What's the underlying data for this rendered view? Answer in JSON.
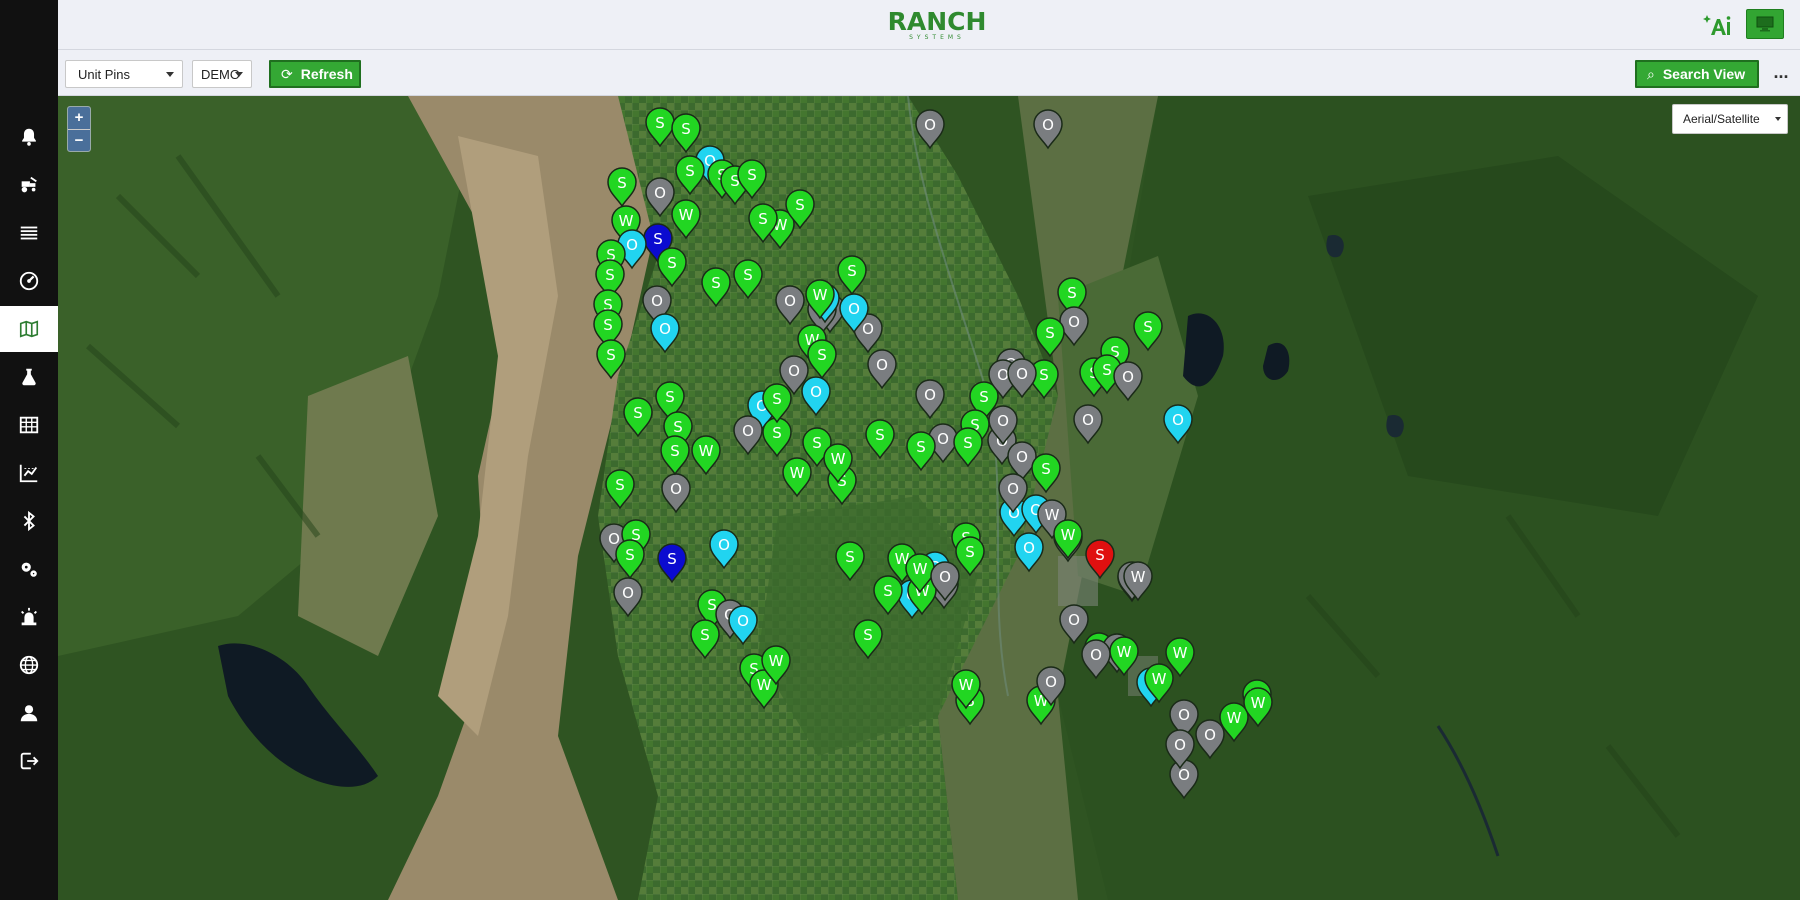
{
  "app": {
    "logo_text": "RANCH",
    "logo_subtext": "SYSTEMS"
  },
  "sidebar": {
    "items": [
      {
        "icon": "bell-icon"
      },
      {
        "icon": "tractor-icon"
      },
      {
        "icon": "list-icon"
      },
      {
        "icon": "gauge-icon"
      },
      {
        "icon": "map-icon",
        "active": true
      },
      {
        "icon": "flask-icon"
      },
      {
        "icon": "table-icon"
      },
      {
        "icon": "chart-grid-icon"
      },
      {
        "icon": "bluetooth-icon"
      },
      {
        "icon": "settings-icon"
      },
      {
        "icon": "alarm-icon"
      },
      {
        "icon": "globe-icon"
      },
      {
        "icon": "user-icon"
      },
      {
        "icon": "logout-icon"
      }
    ]
  },
  "toolbar": {
    "view_select": "Unit Pins",
    "account_select": "DEMO",
    "refresh_label": "Refresh",
    "search_view_label": "Search View",
    "more_label": "..."
  },
  "map": {
    "zoom_in": "+",
    "zoom_out": "−",
    "layer_select": "Aerial/Satellite",
    "pin_colors": {
      "S": "#22d622",
      "W": "#22d622",
      "O": "#7a7d80",
      "cyan": "#21d4f0",
      "blue": "#0b0bd0",
      "red": "#e01010"
    },
    "pins": [
      {
        "label": "S",
        "color": "green"
      },
      {
        "label": "S",
        "color": "green"
      },
      {
        "label": "O",
        "color": "gray"
      },
      {
        "label": "O",
        "color": "gray"
      },
      {
        "label": "S",
        "color": "green"
      },
      {
        "label": "W",
        "color": "green"
      },
      {
        "label": "O",
        "color": "cyan"
      },
      {
        "label": "S",
        "color": "green"
      },
      {
        "label": "S",
        "color": "green"
      },
      {
        "label": "O",
        "color": "gray"
      },
      {
        "label": "W",
        "color": "green"
      },
      {
        "label": "S",
        "color": "blue"
      },
      {
        "label": "S",
        "color": "green"
      },
      {
        "label": "S",
        "color": "green"
      },
      {
        "label": "W",
        "color": "green"
      },
      {
        "label": "S",
        "color": "green"
      },
      {
        "label": "S",
        "color": "green"
      },
      {
        "label": "O",
        "color": "cyan"
      },
      {
        "label": "O",
        "color": "gray"
      },
      {
        "label": "S",
        "color": "green"
      },
      {
        "label": "S",
        "color": "green"
      },
      {
        "label": "S",
        "color": "green"
      },
      {
        "label": "S",
        "color": "green"
      },
      {
        "label": "O",
        "color": "gray"
      },
      {
        "label": "S",
        "color": "green"
      },
      {
        "label": "S",
        "color": "green"
      },
      {
        "label": "S",
        "color": "green"
      },
      {
        "label": "S",
        "color": "green"
      },
      {
        "label": "O",
        "color": "cyan"
      },
      {
        "label": "O",
        "color": "cyan"
      },
      {
        "label": "O",
        "color": "cyan"
      },
      {
        "label": "W",
        "color": "green"
      },
      {
        "label": "S",
        "color": "green"
      },
      {
        "label": "W",
        "color": "green"
      },
      {
        "label": "S",
        "color": "green"
      },
      {
        "label": "S",
        "color": "green"
      },
      {
        "label": "O",
        "color": "gray"
      },
      {
        "label": "S",
        "color": "green"
      },
      {
        "label": "O",
        "color": "gray"
      },
      {
        "label": "S",
        "color": "green"
      },
      {
        "label": "S",
        "color": "green"
      },
      {
        "label": "O",
        "color": "gray"
      },
      {
        "label": "S",
        "color": "green"
      },
      {
        "label": "S",
        "color": "green"
      },
      {
        "label": "S",
        "color": "green"
      },
      {
        "label": "O",
        "color": "gray"
      },
      {
        "label": "O",
        "color": "gray"
      },
      {
        "label": "S",
        "color": "green"
      },
      {
        "label": "O",
        "color": "cyan"
      },
      {
        "label": "W",
        "color": "green"
      },
      {
        "label": "W",
        "color": "green"
      },
      {
        "label": "O",
        "color": "gray"
      },
      {
        "label": "W",
        "color": "green"
      },
      {
        "label": "O",
        "color": "gray"
      },
      {
        "label": "O",
        "color": "gray"
      },
      {
        "label": "O",
        "color": "cyan"
      },
      {
        "label": "S",
        "color": "green"
      },
      {
        "label": "S",
        "color": "green"
      },
      {
        "label": "O",
        "color": "gray"
      },
      {
        "label": "S",
        "color": "blue"
      },
      {
        "label": "O",
        "color": "gray"
      },
      {
        "label": "S",
        "color": "green"
      },
      {
        "label": "S",
        "color": "green"
      },
      {
        "label": "O",
        "color": "cyan"
      },
      {
        "label": "S",
        "color": "green"
      },
      {
        "label": "S",
        "color": "green"
      },
      {
        "label": "O",
        "color": "gray"
      },
      {
        "label": "O",
        "color": "cyan"
      },
      {
        "label": "S",
        "color": "green"
      },
      {
        "label": "W",
        "color": "green"
      },
      {
        "label": "W",
        "color": "green"
      },
      {
        "label": "S",
        "color": "green"
      },
      {
        "label": "W",
        "color": "green"
      },
      {
        "label": "O",
        "color": "cyan"
      },
      {
        "label": "O",
        "color": "gray"
      },
      {
        "label": "O",
        "color": "cyan"
      },
      {
        "label": "W",
        "color": "green"
      },
      {
        "label": "S",
        "color": "green"
      },
      {
        "label": "S",
        "color": "green"
      },
      {
        "label": "S",
        "color": "green"
      },
      {
        "label": "S",
        "color": "green"
      },
      {
        "label": "O",
        "color": "gray"
      },
      {
        "label": "S",
        "color": "green"
      },
      {
        "label": "O",
        "color": "gray"
      },
      {
        "label": "S",
        "color": "green"
      },
      {
        "label": "S",
        "color": "green"
      },
      {
        "label": "O",
        "color": "gray"
      },
      {
        "label": "O",
        "color": "gray"
      },
      {
        "label": "S",
        "color": "green"
      },
      {
        "label": "S",
        "color": "green"
      },
      {
        "label": "O",
        "color": "cyan"
      },
      {
        "label": "S",
        "color": "green"
      },
      {
        "label": "S",
        "color": "green"
      },
      {
        "label": "O",
        "color": "cyan"
      },
      {
        "label": "O",
        "color": "gray"
      },
      {
        "label": "O",
        "color": "gray"
      },
      {
        "label": "S",
        "color": "green"
      },
      {
        "label": "O",
        "color": "gray"
      },
      {
        "label": "O",
        "color": "gray"
      },
      {
        "label": "O",
        "color": "gray"
      },
      {
        "label": "O",
        "color": "gray"
      },
      {
        "label": "S",
        "color": "green"
      },
      {
        "label": "S",
        "color": "green"
      },
      {
        "label": "S",
        "color": "green"
      },
      {
        "label": "S",
        "color": "green"
      },
      {
        "label": "S",
        "color": "green"
      },
      {
        "label": "O",
        "color": "gray"
      },
      {
        "label": "O",
        "color": "cyan"
      },
      {
        "label": "W",
        "color": "green"
      },
      {
        "label": "W",
        "color": "green"
      },
      {
        "label": "O",
        "color": "gray"
      },
      {
        "label": "W",
        "color": "green"
      },
      {
        "label": "O",
        "color": "gray"
      },
      {
        "label": "W",
        "color": "green"
      },
      {
        "label": "O",
        "color": "gray"
      },
      {
        "label": "W",
        "color": "green"
      },
      {
        "label": "O",
        "color": "cyan"
      },
      {
        "label": "W",
        "color": "green"
      },
      {
        "label": "O",
        "color": "gray"
      },
      {
        "label": "W",
        "color": "green"
      },
      {
        "label": "W",
        "color": "green"
      },
      {
        "label": "W",
        "color": "green"
      },
      {
        "label": "O",
        "color": "gray"
      },
      {
        "label": "O",
        "color": "gray"
      },
      {
        "label": "O",
        "color": "gray"
      },
      {
        "label": "O",
        "color": "gray"
      },
      {
        "label": "O",
        "color": "cyan"
      },
      {
        "label": "W",
        "color": "gray"
      },
      {
        "label": "O",
        "color": "gray"
      },
      {
        "label": "W",
        "color": "green"
      },
      {
        "label": "S",
        "color": "red"
      },
      {
        "label": "W",
        "color": "green"
      },
      {
        "label": "O",
        "color": "gray"
      },
      {
        "label": "W",
        "color": "gray"
      },
      {
        "label": "W",
        "color": "green"
      },
      {
        "label": "O",
        "color": "gray"
      },
      {
        "label": "O",
        "color": "gray"
      },
      {
        "label": "O",
        "color": "gray"
      },
      {
        "label": "W",
        "color": "green"
      },
      {
        "label": "O",
        "color": "cyan"
      },
      {
        "label": "O",
        "color": "gray"
      },
      {
        "label": "S",
        "color": "green"
      },
      {
        "label": "S",
        "color": "green"
      },
      {
        "label": "O",
        "color": "gray"
      }
    ]
  }
}
